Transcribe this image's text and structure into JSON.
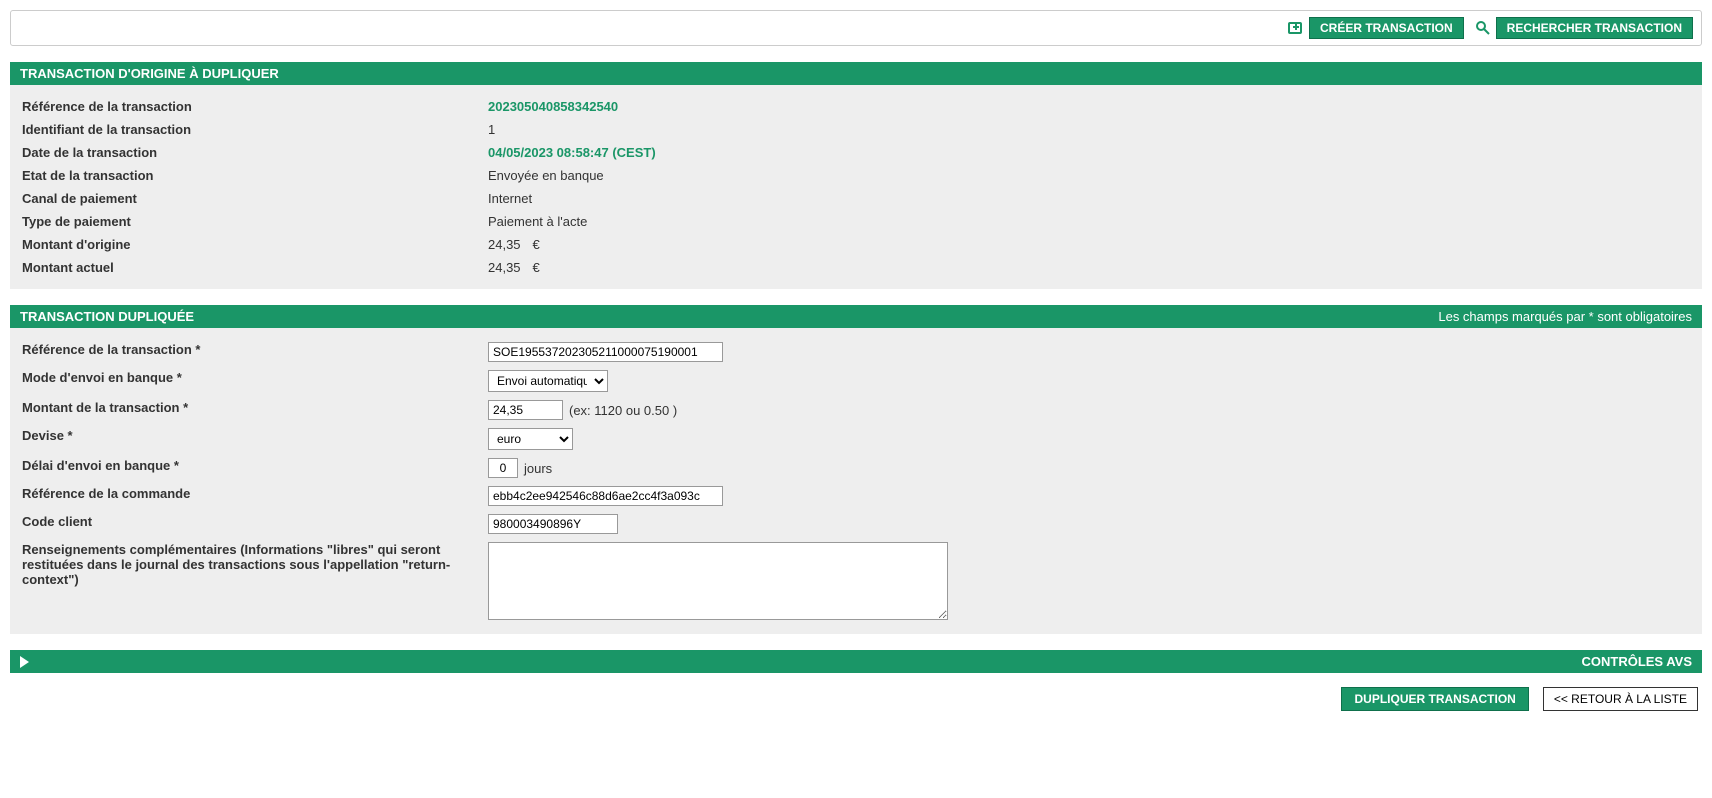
{
  "toolbar": {
    "create_label": "CRÉER TRANSACTION",
    "search_label": "RECHERCHER TRANSACTION"
  },
  "origin": {
    "title": "TRANSACTION D'ORIGINE À DUPLIQUER",
    "ref_label": "Référence de la transaction",
    "ref_value": "202305040858342540",
    "id_label": "Identifiant de la transaction",
    "id_value": "1",
    "date_label": "Date de la transaction",
    "date_value": "04/05/2023 08:58:47 (CEST)",
    "state_label": "Etat de la transaction",
    "state_value": "Envoyée en banque",
    "channel_label": "Canal de paiement",
    "channel_value": "Internet",
    "type_label": "Type de paiement",
    "type_value": "Paiement à l'acte",
    "orig_amount_label": "Montant d'origine",
    "orig_amount_value": "24,35",
    "orig_amount_cur": "€",
    "curr_amount_label": "Montant actuel",
    "curr_amount_value": "24,35",
    "curr_amount_cur": "€"
  },
  "dup": {
    "title": "TRANSACTION DUPLIQUÉE",
    "required_note": "Les champs marqués par * sont obligatoires",
    "ref_label": "Référence de la transaction *",
    "ref_value": "SOE195537202305211000075190001",
    "mode_label": "Mode d'envoi en banque *",
    "mode_value": "Envoi automatique",
    "amount_label": "Montant de la transaction *",
    "amount_value": "24,35",
    "amount_hint": "(ex: 1120 ou 0.50 )",
    "currency_label": "Devise *",
    "currency_value": "euro",
    "delay_label": "Délai d'envoi en banque *",
    "delay_value": "0",
    "delay_unit": "jours",
    "order_ref_label": "Référence de la commande",
    "order_ref_value": "ebb4c2ee942546c88d6ae2cc4f3a093c",
    "client_code_label": "Code client",
    "client_code_value": "980003490896Y",
    "extra_label": "Renseignements complémentaires (Informations \"libres\" qui seront restituées dans le journal des transactions sous l'appellation \"return-context\")",
    "extra_value": ""
  },
  "avs": {
    "title": "CONTRÔLES AVS"
  },
  "actions": {
    "duplicate_label": "DUPLIQUER TRANSACTION",
    "back_label": "<< RETOUR À LA LISTE"
  }
}
